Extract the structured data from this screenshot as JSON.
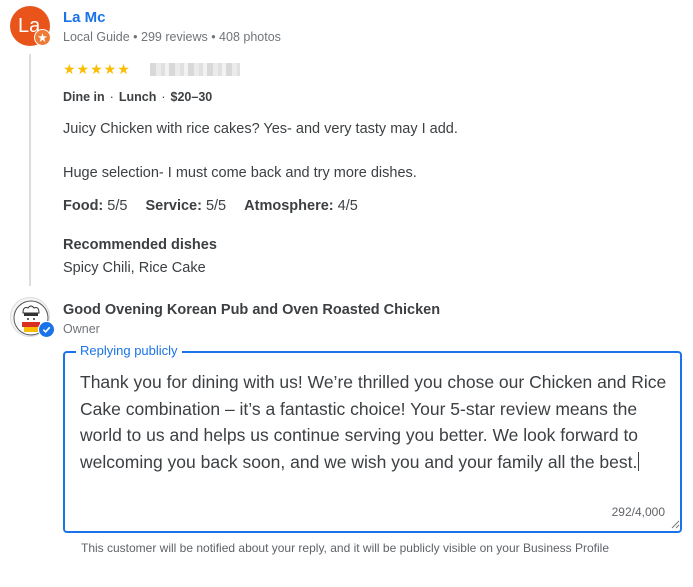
{
  "review": {
    "avatar_initials": "La",
    "reviewer_name": "La Mc",
    "reviewer_meta": "Local Guide • 299 reviews • 408 photos",
    "stars": "★★★★★",
    "rating": 5,
    "visit": {
      "mode": "Dine in",
      "meal": "Lunch",
      "price": "$20–30",
      "separator": "·"
    },
    "text_line_1": "Juicy Chicken with rice cakes? Yes- and very tasty may I add.",
    "text_line_2": "Huge selection- I must come back and try more dishes.",
    "ratings": [
      {
        "label": "Food:",
        "value": "5/5"
      },
      {
        "label": "Service:",
        "value": "5/5"
      },
      {
        "label": "Atmosphere:",
        "value": "4/5"
      }
    ],
    "recommended_title": "Recommended dishes",
    "recommended_dishes": "Spicy Chili, Rice Cake"
  },
  "owner": {
    "name": "Good Ovening Korean Pub and Oven Roasted Chicken",
    "role": "Owner"
  },
  "reply": {
    "legend": "Replying publicly",
    "text": "Thank you for dining with us! We’re thrilled you chose our Chicken and Rice Cake combination – it’s a fantastic choice! Your 5-star review means the world to us and helps us continue serving you better. We look forward to welcoming you back soon, and we wish you and your family all the best.",
    "char_count": "292/4,000",
    "helper_text": "This customer will be notified about your reply, and it will be publicly visible on your Business Profile"
  },
  "colors": {
    "accent": "#1a73e8",
    "star": "#fbbc04",
    "avatar": "#e8541a"
  }
}
